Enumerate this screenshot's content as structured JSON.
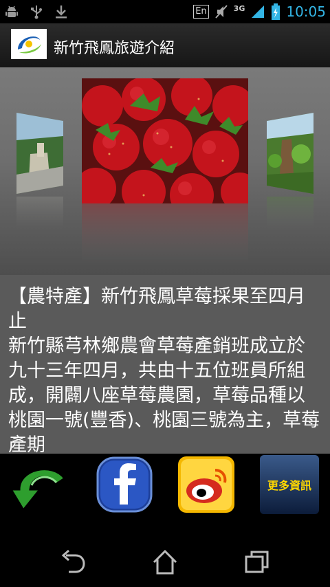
{
  "status_bar": {
    "icons_left": [
      "android-debug-icon",
      "usb-icon",
      "download-icon"
    ],
    "input_method": "En",
    "network": "3G",
    "time": "10:05",
    "accent": "#33b5e5"
  },
  "app": {
    "title": "新竹飛鳳旅遊介紹"
  },
  "gallery": {
    "images": [
      "village-road-photo",
      "strawberries-photo",
      "forest-photo"
    ],
    "selected_index": 1
  },
  "article": {
    "heading": "【農特產】新竹飛鳳草莓採果至四月止",
    "body": "新竹縣芎林鄉農會草莓產銷班成立於九十三年四月，共由十五位班員所組成，開闢八座草莓農園，草莓品種以桃園一號(豐香)、桃園三號為主，草莓產期"
  },
  "actions": {
    "more_info_label": "更多資訊"
  }
}
